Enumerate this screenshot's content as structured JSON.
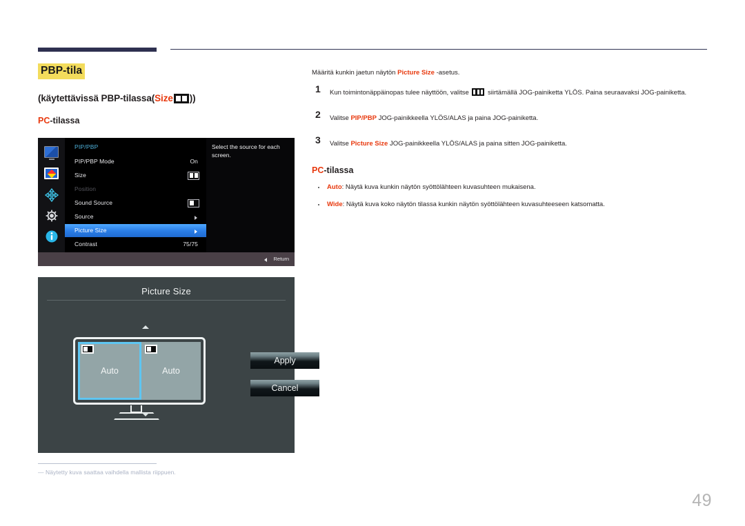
{
  "page": {
    "number": "49"
  },
  "left": {
    "title": "PBP-tila",
    "subtitle_prefix": "(käytettävissä PBP-tilassa(",
    "subtitle_size_word": "Size",
    "subtitle_suffix": "))",
    "mode_label_red": "PC",
    "mode_label_rest": "-tilassa",
    "footnote_text": "―  Näytetty kuva saattaa vaihdella mallista riippuen."
  },
  "osd_menu": {
    "title": "PIP/PBP",
    "help_text": "Select the source for each screen.",
    "return_label": "Return",
    "sidebar_icons": [
      "monitor-icon",
      "picture-icon",
      "position-arrows-icon",
      "gear-icon",
      "info-icon"
    ],
    "rows": [
      {
        "label": "PIP/PBP Mode",
        "value": "On",
        "kind": "text"
      },
      {
        "label": "Size",
        "value": "",
        "kind": "icon-split-even"
      },
      {
        "label": "Position",
        "value": "",
        "kind": "dim"
      },
      {
        "label": "Sound Source",
        "value": "",
        "kind": "icon-left-filled"
      },
      {
        "label": "Source",
        "value": "",
        "kind": "arrow"
      },
      {
        "label": "Picture Size",
        "value": "",
        "kind": "arrow-highlighted"
      },
      {
        "label": "Contrast",
        "value": "75/75",
        "kind": "text"
      }
    ]
  },
  "osd_dialog": {
    "title": "Picture Size",
    "left_pane_label": "Auto",
    "right_pane_label": "Auto",
    "apply_label": "Apply",
    "cancel_label": "Cancel"
  },
  "right": {
    "intro_before": "Määritä kunkin jaetun näytön ",
    "intro_bold": "Picture Size",
    "intro_after": " -asetus.",
    "steps": [
      {
        "num": "1",
        "before": "Kun toimintonäppäinopas tulee näyttöön, valitse ",
        "icon": "three-bars-icon",
        "after": " siirtämällä JOG-painiketta YLÖS. Paina seuraavaksi JOG-painiketta."
      },
      {
        "num": "2",
        "before": "Valitse ",
        "bold": "PIP/PBP",
        "after": " JOG-painikkeella YLÖS/ALAS ja paina JOG-painiketta."
      },
      {
        "num": "3",
        "before": "Valitse ",
        "bold": "Picture Size",
        "after": " JOG-painikkeella YLÖS/ALAS ja paina sitten JOG-painiketta."
      }
    ],
    "pc_head_red": "PC",
    "pc_head_rest": "-tilassa",
    "bullets": [
      {
        "bold": "Auto",
        "text": ": Näytä kuva kunkin näytön syöttölähteen kuvasuhteen mukaisena."
      },
      {
        "bold": "Wide",
        "text": ": Näytä kuva koko näytön tilassa kunkin näytön syöttölähteen kuvasuhteeseen katsomatta."
      }
    ]
  },
  "colors": {
    "accent_red": "#e8380d",
    "highlight_yellow": "#f3dc5c",
    "navy": "#2e3050",
    "osd_blue": "#2b7fe8",
    "osd_title_blue": "#4fb3dd",
    "select_cyan": "#5ec6f2"
  }
}
